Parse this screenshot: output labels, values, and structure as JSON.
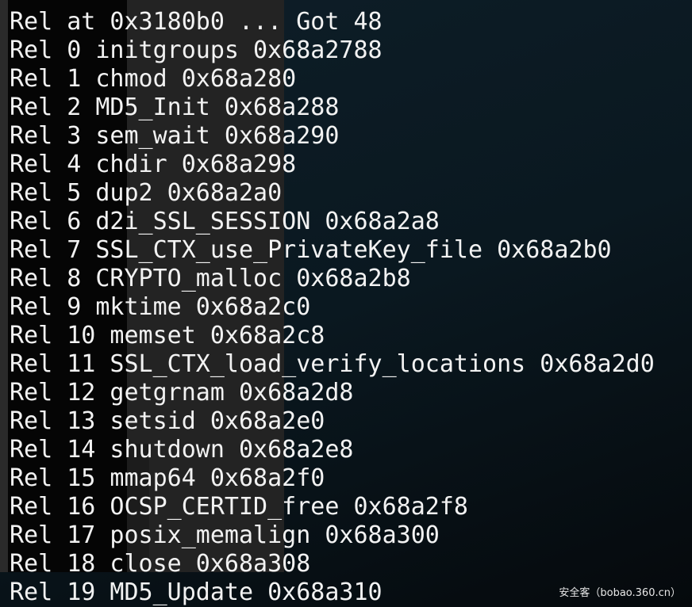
{
  "terminal": {
    "lines": [
      "Rel at 0x3180b0 ... Got 48",
      "Rel 0 initgroups 0x68a2788",
      "Rel 1 chmod 0x68a280",
      "Rel 2 MD5_Init 0x68a288",
      "Rel 3 sem_wait 0x68a290",
      "Rel 4 chdir 0x68a298",
      "Rel 5 dup2 0x68a2a0",
      "Rel 6 d2i_SSL_SESSION 0x68a2a8",
      "Rel 7 SSL_CTX_use_PrivateKey_file 0x68a2b0",
      "Rel 8 CRYPTO_malloc 0x68a2b8",
      "Rel 9 mktime 0x68a2c0",
      "Rel 10 memset 0x68a2c8",
      "Rel 11 SSL_CTX_load_verify_locations 0x68a2d0",
      "Rel 12 getgrnam 0x68a2d8",
      "Rel 13 setsid 0x68a2e0",
      "Rel 14 shutdown 0x68a2e8",
      "Rel 15 mmap64 0x68a2f0",
      "Rel 16 OCSP_CERTID_free 0x68a2f8",
      "Rel 17 posix_memalign 0x68a300",
      "Rel 18 close 0x68a308",
      "Rel 19 MD5_Update 0x68a310"
    ]
  },
  "watermark": "安全客（bobao.360.cn）"
}
